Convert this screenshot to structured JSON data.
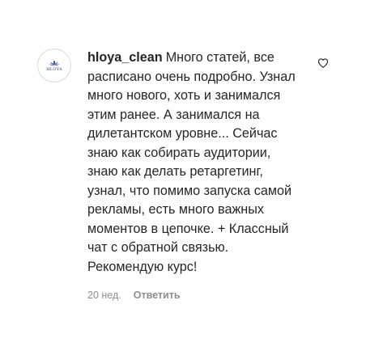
{
  "comment": {
    "avatar": {
      "brand_text": "HLOYA",
      "icon": "lotus-logo-icon",
      "brand_color": "#2d3a66"
    },
    "username": "hloya_clean",
    "text": "Много статей, все расписано очень подробно. Узнал много нового, хоть и занимался этим ранее. А занимался на дилетантском уровне... Сейчас знаю как собирать аудитории, знаю как делать ретаргетинг, узнал, что помимо запуска самой рекламы, есть много важных моментов в цепочке. + Классный чат с обратной связью. Рекомендую курс!",
    "timestamp": "20 нед.",
    "reply_label": "Ответить",
    "like_icon": "heart-outline-icon"
  },
  "colors": {
    "text": "#262626",
    "secondary": "#8e8e8e",
    "border": "#dbdbdb"
  }
}
